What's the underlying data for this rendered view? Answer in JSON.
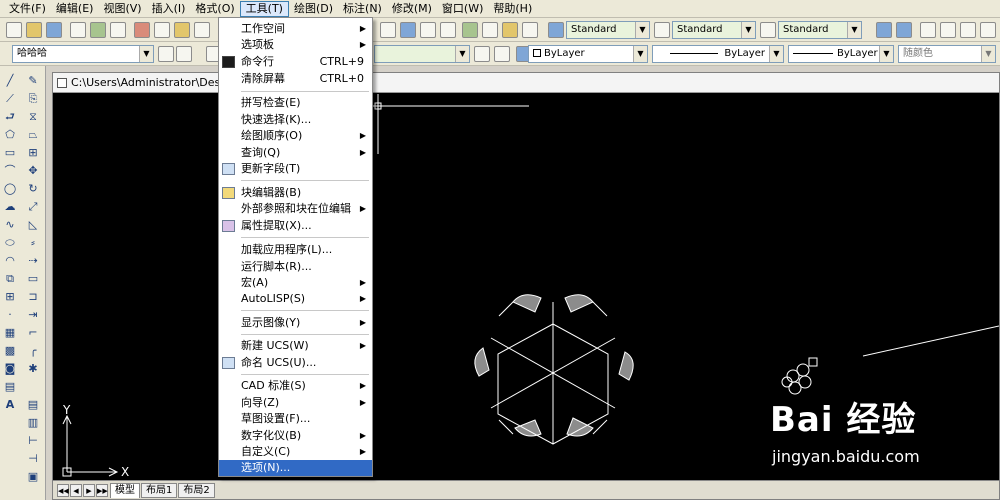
{
  "menubar": {
    "items": [
      "文件(F)",
      "编辑(E)",
      "视图(V)",
      "插入(I)",
      "格式(O)",
      "工具(T)",
      "绘图(D)",
      "标注(N)",
      "修改(M)",
      "窗口(W)",
      "帮助(H)"
    ]
  },
  "toolbar": {
    "layer_name": "哈哈哈",
    "text_style": "Standard",
    "dim_style": "Standard",
    "table_style": "Standard",
    "color": "ByLayer",
    "linetype": "ByLayer",
    "lineweight": "ByLayer",
    "plotstyle": "随颜色"
  },
  "document": {
    "title": "C:\\Users\\Administrator\\Deskto",
    "tabs": [
      "模型",
      "布局1",
      "布局2"
    ],
    "ucs_x": "X",
    "ucs_y": "Y"
  },
  "tools_menu": {
    "items": [
      {
        "label": "工作空间",
        "submenu": true
      },
      {
        "label": "选项板",
        "submenu": true
      },
      {
        "label": "命令行",
        "shortcut": "CTRL+9",
        "icon": "command-line-icon"
      },
      {
        "label": "清除屏幕",
        "shortcut": "CTRL+0"
      },
      {
        "label": "拼写检查(E)"
      },
      {
        "label": "快速选择(K)..."
      },
      {
        "label": "绘图顺序(O)",
        "submenu": true
      },
      {
        "label": "查询(Q)",
        "submenu": true
      },
      {
        "label": "更新字段(T)",
        "icon": "update-field-icon"
      },
      {
        "label": "块编辑器(B)",
        "icon": "block-editor-icon"
      },
      {
        "label": "外部参照和块在位编辑",
        "submenu": true
      },
      {
        "label": "属性提取(X)...",
        "icon": "attribute-extract-icon"
      },
      {
        "label": "加载应用程序(L)..."
      },
      {
        "label": "运行脚本(R)..."
      },
      {
        "label": "宏(A)",
        "submenu": true
      },
      {
        "label": "AutoLISP(S)",
        "submenu": true
      },
      {
        "label": "显示图像(Y)",
        "submenu": true
      },
      {
        "label": "新建 UCS(W)",
        "submenu": true
      },
      {
        "label": "命名 UCS(U)...",
        "icon": "named-ucs-icon"
      },
      {
        "label": "CAD 标准(S)",
        "submenu": true
      },
      {
        "label": "向导(Z)",
        "submenu": true
      },
      {
        "label": "草图设置(F)..."
      },
      {
        "label": "数字化仪(B)",
        "submenu": true
      },
      {
        "label": "自定义(C)",
        "submenu": true
      },
      {
        "label": "选项(N)...",
        "highlighted": true
      }
    ]
  },
  "watermark": {
    "brand": "Bai 经验",
    "url": "jingyan.baidu.com"
  }
}
